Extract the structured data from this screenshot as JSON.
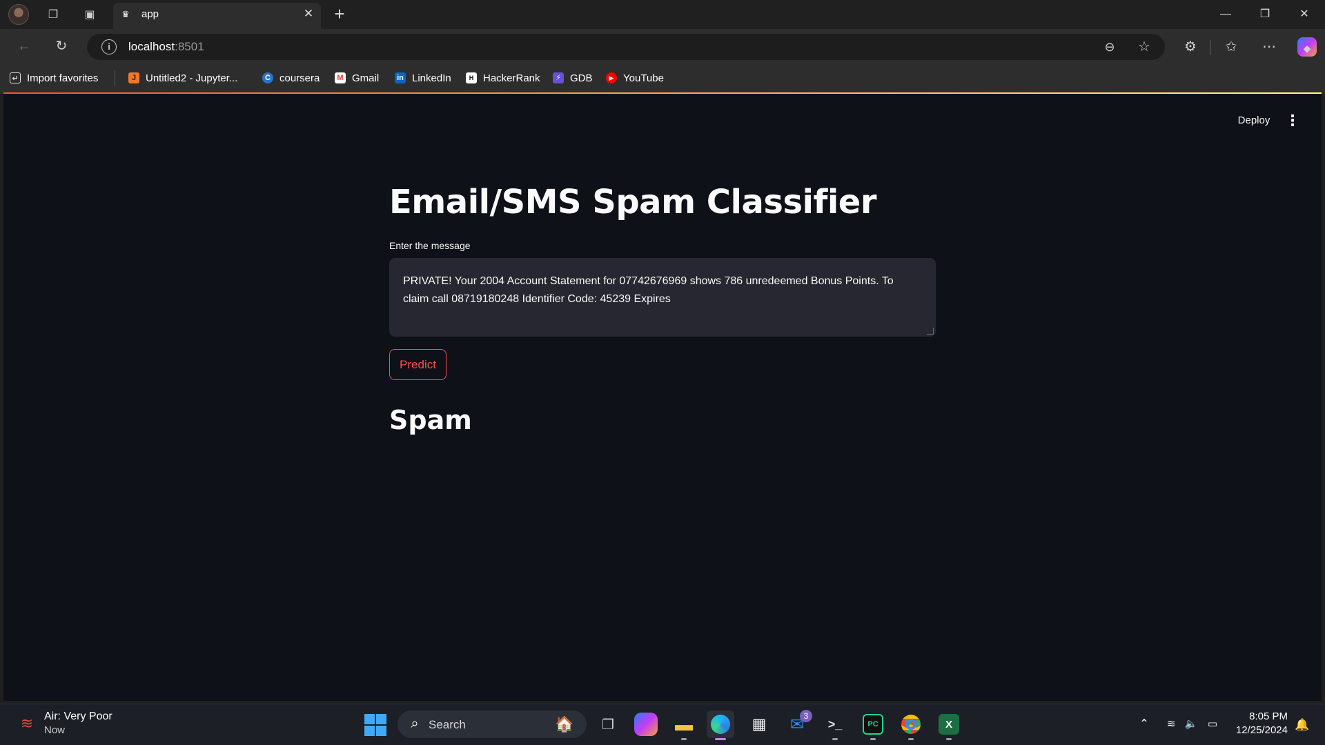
{
  "browser": {
    "tab_title": "app",
    "url_host": "localhost",
    "url_port": ":8501",
    "bookmarks": [
      {
        "label": "Import favorites",
        "icon": "import-icon"
      },
      {
        "label": "Untitled2 - Jupyter...",
        "icon": "jupyter-icon"
      },
      {
        "label": "coursera",
        "icon": "coursera-icon"
      },
      {
        "label": "Gmail",
        "icon": "gmail-icon"
      },
      {
        "label": "LinkedIn",
        "icon": "linkedin-icon"
      },
      {
        "label": "HackerRank",
        "icon": "hackerrank-icon"
      },
      {
        "label": "GDB",
        "icon": "gdb-icon"
      },
      {
        "label": "YouTube",
        "icon": "youtube-icon"
      }
    ]
  },
  "app": {
    "deploy_label": "Deploy",
    "title": "Email/SMS Spam Classifier",
    "input_label": "Enter the message",
    "message_value": "PRIVATE! Your 2004 Account Statement for 07742676969 shows 786 unredeemed Bonus Points. To claim call 08719180248 Identifier Code: 45239 Expires",
    "predict_label": "Predict",
    "result": "Spam",
    "accent_color": "#ff4b4b",
    "background_color": "#0e1117"
  },
  "taskbar": {
    "weather_title": "Air: Very Poor",
    "weather_sub": "Now",
    "search_placeholder": "Search",
    "mail_badge": "3",
    "time": "8:05 PM",
    "date": "12/25/2024"
  }
}
